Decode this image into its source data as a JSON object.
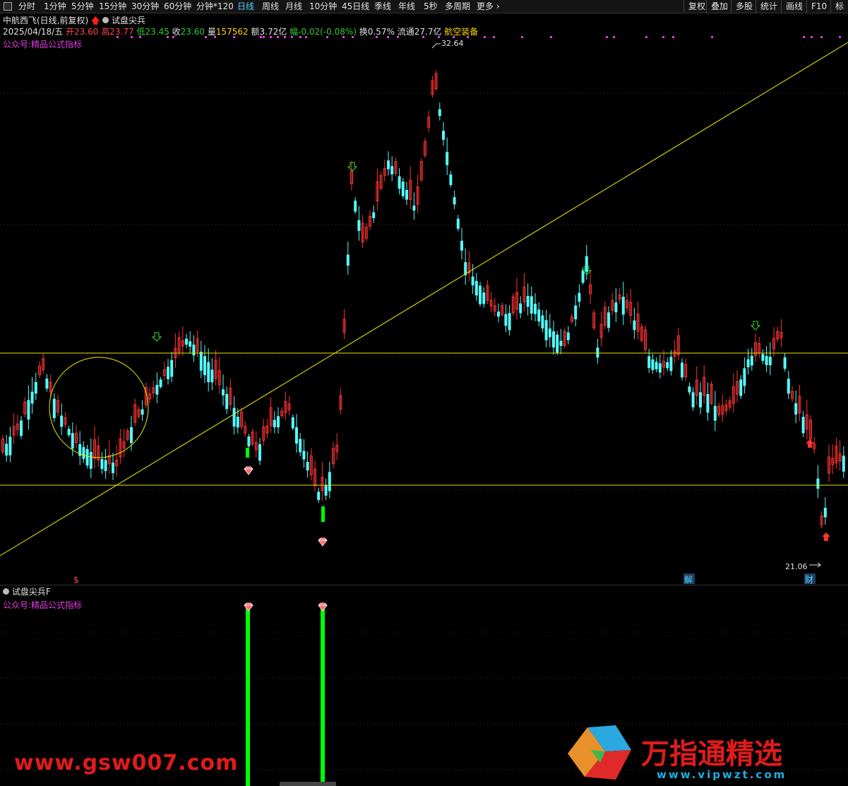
{
  "toolbar": {
    "periods": [
      "分时",
      "1分钟",
      "5分钟",
      "15分钟",
      "30分钟",
      "60分钟",
      "分钟*120",
      "日线",
      "周线",
      "月线",
      "10分钟",
      "45日线",
      "季线",
      "年线",
      "5秒",
      "多周期",
      "更多"
    ],
    "active": "日线",
    "right_tools": [
      "复权",
      "叠加",
      "多股",
      "统计",
      "画线",
      "F10",
      "标"
    ]
  },
  "header": {
    "stock": "中航西飞(日线,前复权)",
    "indicator_name": "试盘尖兵",
    "date": "2025/04/18/五",
    "open_label": "开",
    "open": "23.60",
    "high_label": "高",
    "high": "23.77",
    "low_label": "低",
    "low": "23.45",
    "close_label": "收",
    "close": "23.60",
    "vol_label": "量",
    "vol": "157562",
    "amount": "额3.72亿",
    "change": "幅-0.02(-0.08%)",
    "turnover": "换0.57%",
    "float_cap": "流通27.7亿",
    "sector": "航空装备"
  },
  "main_panel": {
    "watermark_text": "公众号:精品公式指标",
    "high_mark": "32.64",
    "low_mark": "21.06",
    "event_markers": [
      "$",
      "解",
      "财"
    ]
  },
  "sub_panel": {
    "title": "试盘尖兵F",
    "watermark_text": "公众号:精品公式指标"
  },
  "watermarks": {
    "left": "www.gsw007.com",
    "right": "万指通精选",
    "right_url": "www.vipwzt.com"
  },
  "colors": {
    "up": "#ff3232",
    "down": "#54fcfc",
    "line": "#e8e800",
    "signal": "#00ff00",
    "accent": "#e23ce2"
  },
  "chart_data": {
    "type": "candlestick",
    "price_range": [
      21.06,
      32.64
    ],
    "last_bar": {
      "open": 23.6,
      "high": 23.77,
      "low": 23.45,
      "close": 23.6
    },
    "signal_count": 2
  }
}
